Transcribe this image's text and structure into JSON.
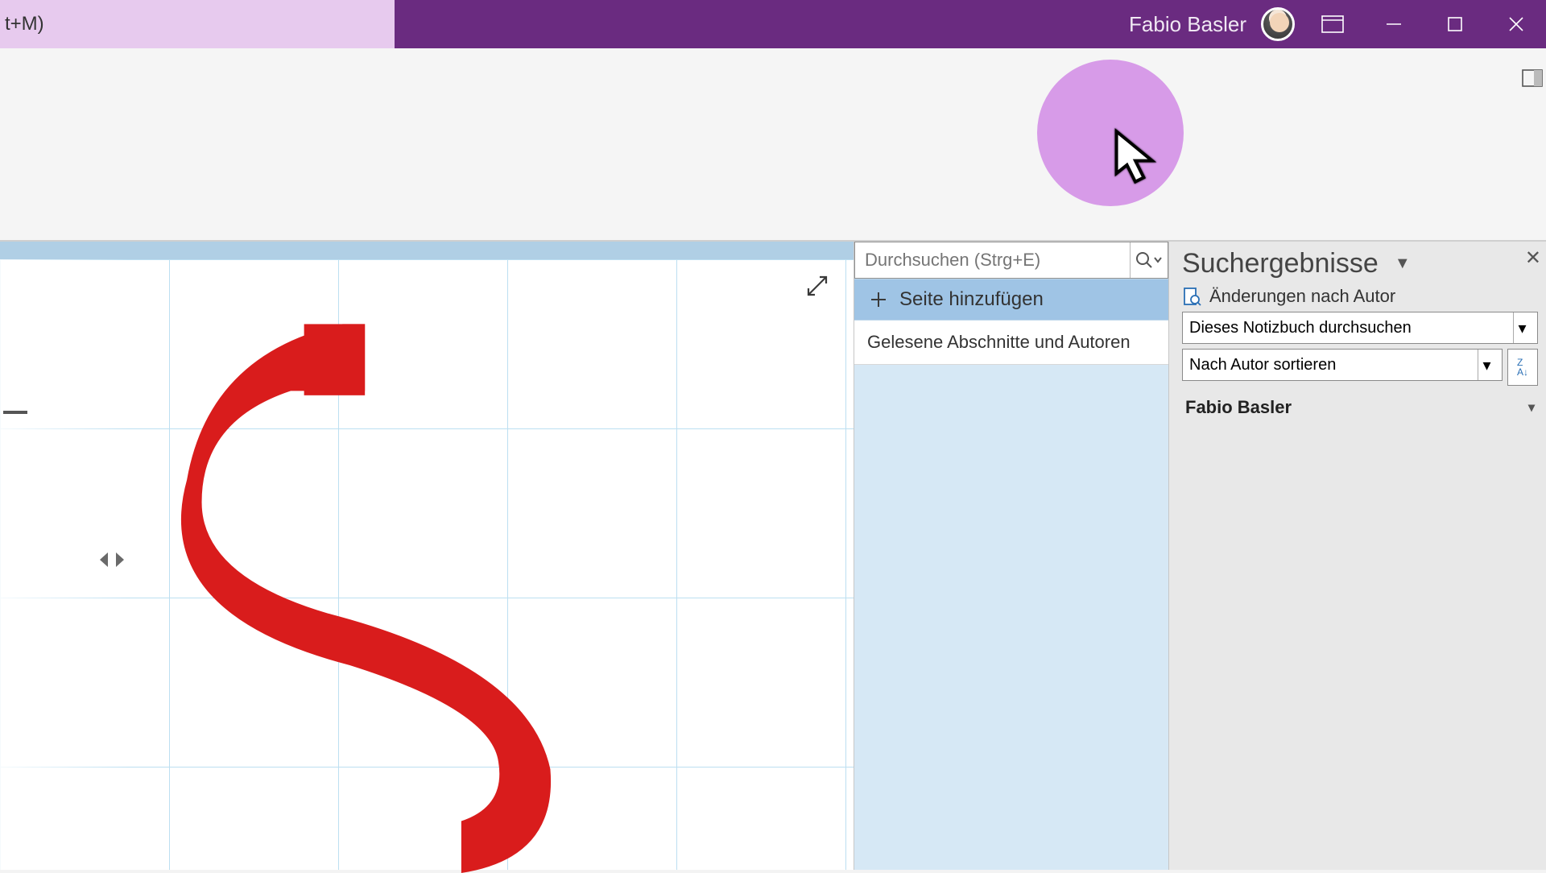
{
  "titlebar": {
    "shortcut_hint": "t+M)",
    "user_name": "Fabio Basler"
  },
  "search": {
    "placeholder": "Durchsuchen (Strg+E)"
  },
  "pages_pane": {
    "add_page_label": "Seite hinzufügen",
    "item_label": "Gelesene Abschnitte und Autoren"
  },
  "results_pane": {
    "title": "Suchergebnisse",
    "changes_by_author": "Änderungen nach Autor",
    "scope_dropdown": "Dieses Notizbuch durchsuchen",
    "sort_dropdown": "Nach Autor sortieren",
    "author": "Fabio Basler"
  }
}
